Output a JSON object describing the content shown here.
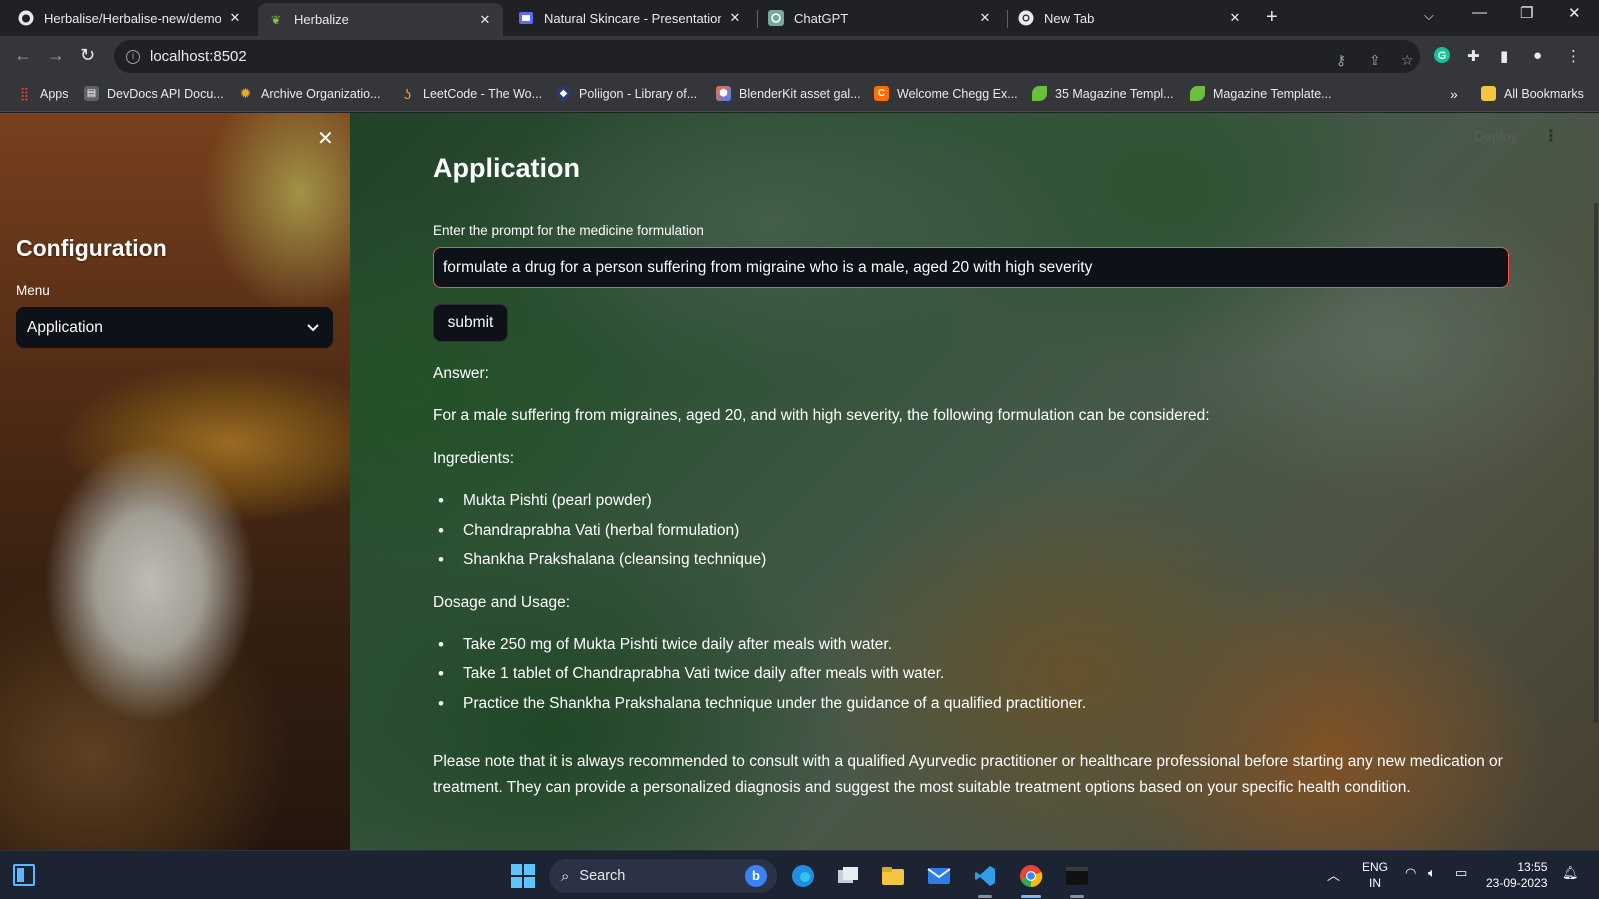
{
  "browser": {
    "tabs": [
      {
        "title": "Herbalise/Herbalise-new/demo.p",
        "favicon": "github-icon"
      },
      {
        "title": "Herbalize",
        "favicon": "herb-leaf-icon"
      },
      {
        "title": "Natural Skincare - Presentation",
        "favicon": "slides-icon"
      },
      {
        "title": "ChatGPT",
        "favicon": "chatgpt-icon"
      },
      {
        "title": "New Tab",
        "favicon": "chrome-icon"
      }
    ],
    "active_tab": 1,
    "url": "localhost:8502",
    "bookmarks": [
      {
        "label": "Apps",
        "icon": "apps-grid-icon"
      },
      {
        "label": "DevDocs API Docu...",
        "icon": "devdocs-icon"
      },
      {
        "label": "Archive Organizatio...",
        "icon": "archive-icon"
      },
      {
        "label": "LeetCode - The Wo...",
        "icon": "leetcode-icon"
      },
      {
        "label": "Poliigon - Library of...",
        "icon": "poliigon-icon"
      },
      {
        "label": "BlenderKit asset gal...",
        "icon": "blenderkit-icon"
      },
      {
        "label": "Welcome Chegg Ex...",
        "icon": "chegg-icon"
      },
      {
        "label": "35 Magazine Templ...",
        "icon": "leaf-icon"
      },
      {
        "label": "Magazine Template...",
        "icon": "leaf-icon"
      }
    ],
    "all_bookmarks_label": "All Bookmarks",
    "overflow_label": "»"
  },
  "sidebar": {
    "heading": "Configuration",
    "menu_label": "Menu",
    "menu_selected": "Application"
  },
  "header": {
    "deploy_label": "Deploy"
  },
  "main": {
    "title": "Application",
    "input_label": "Enter the prompt for the medicine formulation",
    "input_value": "formulate a drug for a person suffering from migraine who is a male, aged 20 with high severity",
    "submit_label": "submit",
    "answer_label": "Answer:",
    "intro": "For a male suffering from migraines, aged 20, and with high severity, the following formulation can be considered:",
    "ingredients_label": "Ingredients:",
    "ingredients": [
      "Mukta Pishti (pearl powder)",
      "Chandraprabha Vati (herbal formulation)",
      "Shankha Prakshalana (cleansing technique)"
    ],
    "dosage_label": "Dosage and Usage:",
    "dosage": [
      "Take 250 mg of Mukta Pishti twice daily after meals with water.",
      "Take 1 tablet of Chandraprabha Vati twice daily after meals with water.",
      "Practice the Shankha Prakshalana technique under the guidance of a qualified practitioner."
    ],
    "note": "Please note that it is always recommended to consult with a qualified Ayurvedic practitioner or healthcare professional before starting any new medication or treatment. They can provide a personalized diagnosis and suggest the most suitable treatment options based on your specific health condition."
  },
  "taskbar": {
    "search_label": "Search",
    "lang_line1": "ENG",
    "lang_line2": "IN",
    "time": "13:55",
    "date": "23-09-2023"
  },
  "colors": {
    "accent_border": "#ff4b4b",
    "widget_bg": "#0e1117",
    "chrome_bg": "#35363a"
  }
}
